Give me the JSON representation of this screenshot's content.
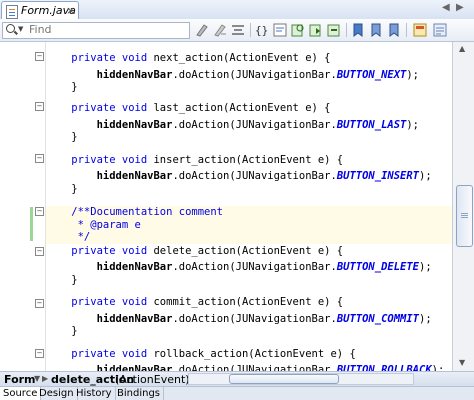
{
  "tab": {
    "label": "Form.java",
    "close": "×"
  },
  "nav": {
    "left": "◀",
    "right": "▶"
  },
  "search": {
    "placeholder": "Find",
    "value": ""
  },
  "toolbar_icons": [
    "comment-icon",
    "uncomment-icon",
    "format-icon",
    "match-brace-icon",
    "toggle-highlight-icon",
    "find-prev-icon",
    "find-next-icon",
    "shift-left-icon",
    "bookmark-icon",
    "bookmark-prev-icon",
    "bookmark-next-icon",
    "macro-icon",
    "diff-icon"
  ],
  "code": {
    "lines": [
      {
        "segments": [
          {
            "t": "    ",
            "c": ""
          },
          {
            "t": "private void",
            "c": "kw"
          },
          {
            "t": " next_action(ActionEvent e) {",
            "c": ""
          }
        ]
      },
      {
        "segments": [
          {
            "t": "        ",
            "c": ""
          },
          {
            "t": "hiddenNavBar",
            "c": "bold"
          },
          {
            "t": ".doAction(JUNavigationBar.",
            "c": ""
          },
          {
            "t": "BUTTON_NEXT",
            "c": "const"
          },
          {
            "t": ");",
            "c": ""
          }
        ]
      },
      {
        "segments": [
          {
            "t": "    }",
            "c": ""
          }
        ]
      },
      {
        "segments": [
          {
            "t": "    ",
            "c": ""
          },
          {
            "t": "private void",
            "c": "kw"
          },
          {
            "t": " last_action(ActionEvent e) {",
            "c": ""
          }
        ]
      },
      {
        "segments": [
          {
            "t": "        ",
            "c": ""
          },
          {
            "t": "hiddenNavBar",
            "c": "bold"
          },
          {
            "t": ".doAction(JUNavigationBar.",
            "c": ""
          },
          {
            "t": "BUTTON_LAST",
            "c": "const"
          },
          {
            "t": ");",
            "c": ""
          }
        ]
      },
      {
        "segments": [
          {
            "t": "    }",
            "c": ""
          }
        ]
      },
      {
        "segments": [
          {
            "t": "    ",
            "c": ""
          },
          {
            "t": "private void",
            "c": "kw"
          },
          {
            "t": " insert_action(ActionEvent e) {",
            "c": ""
          }
        ]
      },
      {
        "segments": [
          {
            "t": "        ",
            "c": ""
          },
          {
            "t": "hiddenNavBar",
            "c": "bold"
          },
          {
            "t": ".doAction(JUNavigationBar.",
            "c": ""
          },
          {
            "t": "BUTTON_INSERT",
            "c": "const"
          },
          {
            "t": ");",
            "c": ""
          }
        ]
      },
      {
        "segments": [
          {
            "t": "    }",
            "c": ""
          }
        ]
      },
      {
        "segments": [
          {
            "t": "    /**Documentation comment",
            "c": "cmt"
          }
        ]
      },
      {
        "segments": [
          {
            "t": "     * @param e",
            "c": "cmt"
          }
        ]
      },
      {
        "segments": [
          {
            "t": "     */",
            "c": "cmt"
          }
        ]
      },
      {
        "segments": [
          {
            "t": "    ",
            "c": ""
          },
          {
            "t": "private void",
            "c": "kw"
          },
          {
            "t": " delete_action(ActionEvent e) {",
            "c": ""
          }
        ]
      },
      {
        "segments": [
          {
            "t": "        ",
            "c": ""
          },
          {
            "t": "hiddenNavBar",
            "c": "bold"
          },
          {
            "t": ".doAction(JUNavigationBar.",
            "c": ""
          },
          {
            "t": "BUTTON_DELETE",
            "c": "const"
          },
          {
            "t": ");",
            "c": ""
          }
        ]
      },
      {
        "segments": [
          {
            "t": "    }",
            "c": ""
          }
        ]
      },
      {
        "segments": [
          {
            "t": "    ",
            "c": ""
          },
          {
            "t": "private void",
            "c": "kw"
          },
          {
            "t": " commit_action(ActionEvent e) {",
            "c": ""
          }
        ]
      },
      {
        "segments": [
          {
            "t": "        ",
            "c": ""
          },
          {
            "t": "hiddenNavBar",
            "c": "bold"
          },
          {
            "t": ".doAction(JUNavigationBar.",
            "c": ""
          },
          {
            "t": "BUTTON_COMMIT",
            "c": "const"
          },
          {
            "t": ");",
            "c": ""
          }
        ]
      },
      {
        "segments": [
          {
            "t": "    }",
            "c": ""
          }
        ]
      },
      {
        "segments": [
          {
            "t": "    ",
            "c": ""
          },
          {
            "t": "private void",
            "c": "kw"
          },
          {
            "t": " rollback_action(ActionEvent e) {",
            "c": ""
          }
        ]
      },
      {
        "segments": [
          {
            "t": "        ",
            "c": ""
          },
          {
            "t": "hiddenNavBar",
            "c": "bold"
          },
          {
            "t": ".doAction(JUNavigationBar.",
            "c": ""
          },
          {
            "t": "BUTTON_ROLLBACK",
            "c": "const"
          },
          {
            "t": ");",
            "c": ""
          }
        ]
      }
    ]
  },
  "breadcrumb": {
    "class_name": "Form",
    "method_name": "delete_action",
    "method_args": "(ActionEvent)"
  },
  "bottom_tabs": [
    "Source",
    "Design",
    "History",
    "Bindings"
  ],
  "colors": {
    "keyword": "#0000e6",
    "highlight": "#fffbe6",
    "accent": "#8ea6c9"
  }
}
